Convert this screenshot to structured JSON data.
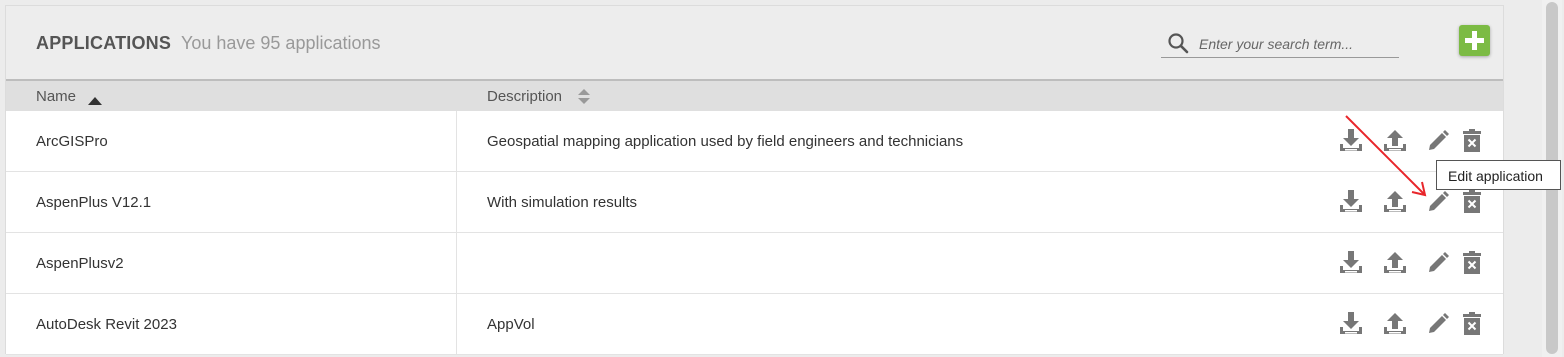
{
  "header": {
    "title": "APPLICATIONS",
    "subtitle": "You have 95 applications"
  },
  "search": {
    "placeholder": "Enter your search term...",
    "icon": "search-icon"
  },
  "add_button": {
    "icon": "plus-icon",
    "color": "#7cbb44"
  },
  "columns": {
    "name": "Name",
    "description": "Description"
  },
  "rows": [
    {
      "name": "ArcGISPro",
      "description": "Geospatial mapping application used by field engineers and technicians"
    },
    {
      "name": "AspenPlus V12.1",
      "description": "With simulation results"
    },
    {
      "name": "AspenPlusv2",
      "description": ""
    },
    {
      "name": "AutoDesk Revit 2023",
      "description": "AppVol"
    }
  ],
  "row_actions": [
    "download-icon",
    "upload-icon",
    "pencil-icon",
    "trash-icon"
  ],
  "tooltip": {
    "text": "Edit application"
  },
  "annotation": {
    "color": "#e8262b"
  }
}
